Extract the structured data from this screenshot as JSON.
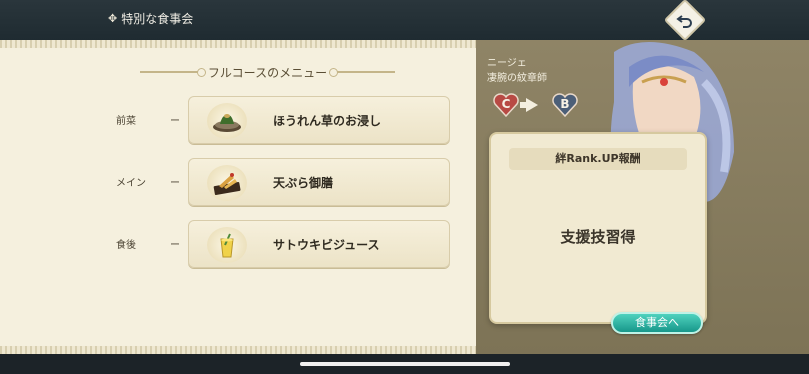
{
  "header": {
    "title_icon": "diamond-icon",
    "title": "特別な食事会",
    "back_icon": "return-arrow-icon"
  },
  "menu": {
    "heading": "フルコースのメニュー",
    "courses": [
      {
        "label": "前菜",
        "dash": "ー",
        "dish": "ほうれん草のお浸し",
        "icon": "spinach-dish-icon"
      },
      {
        "label": "メイン",
        "dash": "ー",
        "dish": "天ぷら御膳",
        "icon": "tempura-dish-icon"
      },
      {
        "label": "食後",
        "dash": "ー",
        "dish": "サトウキビジュース",
        "icon": "juice-glass-icon"
      }
    ]
  },
  "character": {
    "name": "ニージェ",
    "title": "凄腕の紋章師",
    "rank_from": "C",
    "rank_to": "B",
    "rank_from_color": "#b84a44",
    "rank_to_color": "#4c5f78"
  },
  "reward": {
    "heading": "絆Rank.UP報酬",
    "text": "支援技習得"
  },
  "actions": {
    "meal_button": "食事会へ"
  },
  "colors": {
    "accent_teal": "#17978a",
    "panel_cream": "#f5f0de",
    "panel_olive": "#8f8466"
  }
}
